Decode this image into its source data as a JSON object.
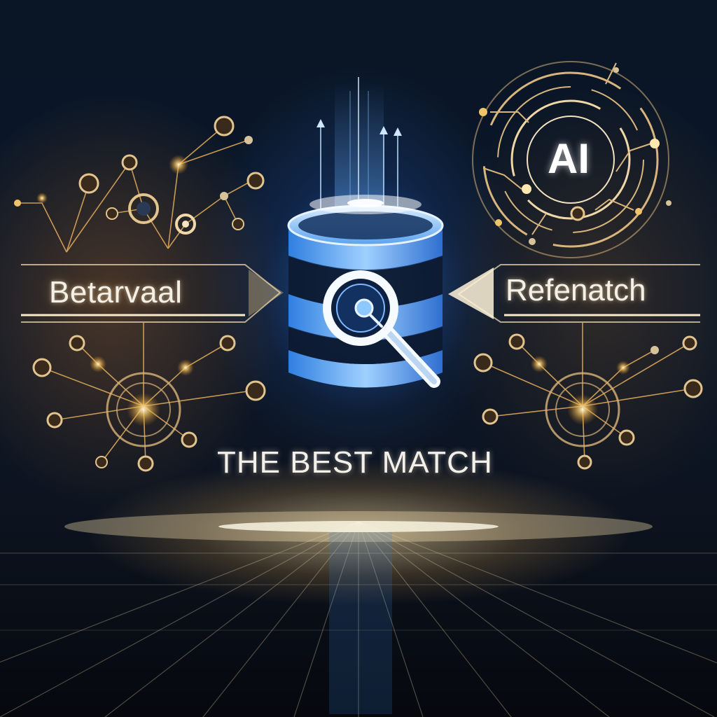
{
  "labels": {
    "left": "Betarvaal",
    "right": "Refenatch",
    "ai_badge": "AI",
    "headline": "THE BEST MATCH"
  },
  "colors": {
    "background": "#0a1626",
    "accent_blue": "#4aa8ff",
    "accent_gold": "#f2c46a",
    "text": "#f4f0e6"
  },
  "icons": {
    "center": "database-icon",
    "overlay": "magnifying-glass-icon",
    "top_right": "ai-circuit-icon"
  }
}
